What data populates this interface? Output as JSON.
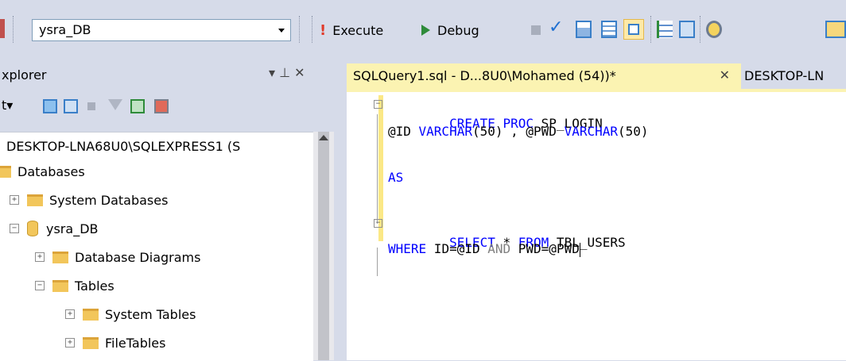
{
  "toolbar": {
    "database_value": "ysra_DB",
    "execute_label": "Execute",
    "debug_label": "Debug"
  },
  "explorer": {
    "title": "xplorer",
    "pin": "▾ ⊥ ✕",
    "connect_label": "t▾",
    "tree": [
      {
        "label": "DESKTOP-LNA68U0\\SQLEXPRESS1 (S",
        "toggle": ""
      },
      {
        "label": "Databases",
        "toggle": ""
      },
      {
        "label": "System Databases",
        "toggle": "+"
      },
      {
        "label": "ysra_DB",
        "toggle": "−"
      },
      {
        "label": "Database Diagrams",
        "toggle": "+"
      },
      {
        "label": "Tables",
        "toggle": "−"
      },
      {
        "label": "System Tables",
        "toggle": "+"
      },
      {
        "label": "FileTables",
        "toggle": "+"
      }
    ]
  },
  "editor": {
    "active_tab": "SQLQuery1.sql - D...8U0\\Mohamed (54))*",
    "active_tab_close": "✕",
    "other_tab": "DESKTOP-LN",
    "code": {
      "l1_kw": "CREATE PROC",
      "l1_rest": " SP_LOGIN",
      "l2_a": "@ID ",
      "l2_kw1": "VARCHAR",
      "l2_b": "(50) , @PWD ",
      "l2_kw2": "VARCHAR",
      "l2_c": "(50)",
      "l4_kw": "AS",
      "l6_kw1": "SELECT",
      "l6_a": " * ",
      "l6_kw2": "FROM",
      "l6_b": " TBL_USERS",
      "l7_kw": "WHERE",
      "l7_a": " ID=@ID ",
      "l7_gray": "AND",
      "l7_b": " PWD=@PWD"
    }
  }
}
